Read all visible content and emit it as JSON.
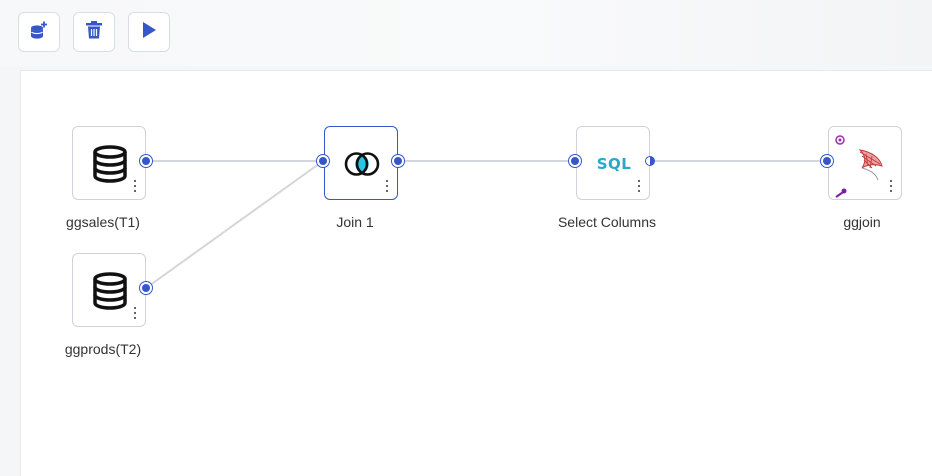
{
  "toolbar": {
    "buttons": [
      {
        "icon": "add-datasource-icon"
      },
      {
        "icon": "trash-icon"
      },
      {
        "icon": "play-icon"
      }
    ]
  },
  "colors": {
    "accent": "#3557c9",
    "sql": "#2aa6cf",
    "edge": "#d3d6da"
  },
  "flow": {
    "nodes": [
      {
        "id": "ggsales",
        "label": "ggsales(T1)",
        "type": "datasource",
        "icon": "database-icon"
      },
      {
        "id": "ggprods",
        "label": "ggprods(T2)",
        "type": "datasource",
        "icon": "database-icon"
      },
      {
        "id": "join1",
        "label": "Join 1",
        "type": "join",
        "icon": "join-icon"
      },
      {
        "id": "select",
        "label": "Select Columns",
        "type": "sql",
        "icon": "sql-icon",
        "icon_text": "SQL"
      },
      {
        "id": "ggjoin",
        "label": "ggjoin",
        "type": "target",
        "icon": "sql-server-icon"
      }
    ],
    "edges": [
      {
        "from": "ggsales",
        "to": "join1"
      },
      {
        "from": "ggprods",
        "to": "join1"
      },
      {
        "from": "join1",
        "to": "select"
      },
      {
        "from": "select",
        "to": "ggjoin"
      }
    ]
  }
}
